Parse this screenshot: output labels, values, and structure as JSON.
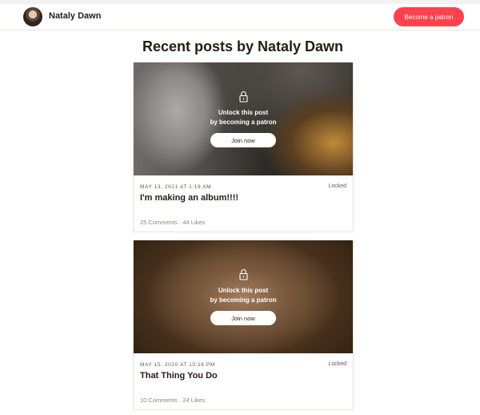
{
  "header": {
    "creator_name": "Nataly Dawn",
    "cta_label": "Become a patron"
  },
  "main": {
    "title": "Recent posts by Nataly Dawn"
  },
  "posts": [
    {
      "date": "MAY 13, 2021 AT 1:19 AM",
      "status": "Locked",
      "title": "I'm making an album!!!!",
      "stats": "25 Comments · 44 Likes",
      "unlock_line1": "Unlock this post",
      "unlock_line2": "by becoming a patron",
      "join_label": "Join now"
    },
    {
      "date": "MAY 15, 2020 AT 10:16 PM",
      "status": "Locked",
      "title": "That Thing You Do",
      "stats": "10 Comments · 24 Likes",
      "unlock_line1": "Unlock this post",
      "unlock_line2": "by becoming a patron",
      "join_label": "Join now"
    }
  ],
  "colors": {
    "accent": "#ff424d",
    "text": "#241e12",
    "muted": "#5f5b54"
  },
  "icons": {
    "lock": "lock-icon"
  }
}
